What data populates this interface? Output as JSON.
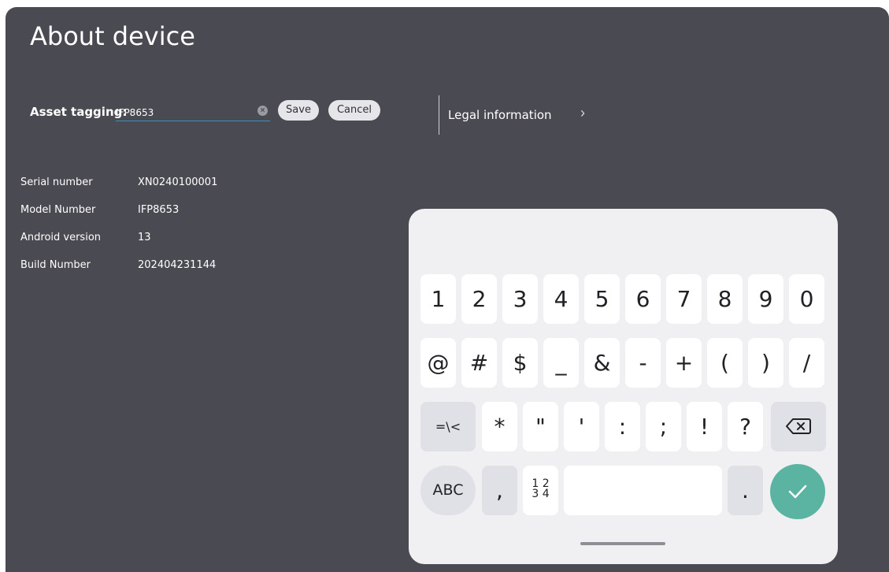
{
  "page": {
    "title": "About device"
  },
  "asset": {
    "label": "Asset tagging:",
    "value": "IFP8653",
    "clear_icon": "clear-icon",
    "save_label": "Save",
    "cancel_label": "Cancel"
  },
  "legal": {
    "label": "Legal information",
    "chevron": "›"
  },
  "info": [
    {
      "label": "Serial number",
      "value": "XN0240100001"
    },
    {
      "label": "Model Number",
      "value": "IFP8653"
    },
    {
      "label": "Android version",
      "value": "13"
    },
    {
      "label": "Build Number",
      "value": "202404231144"
    }
  ],
  "keyboard": {
    "row1": [
      "1",
      "2",
      "3",
      "4",
      "5",
      "6",
      "7",
      "8",
      "9",
      "0"
    ],
    "row2": [
      "@",
      "#",
      "$",
      "_",
      "&",
      "-",
      "+",
      "(",
      ")",
      "/"
    ],
    "row3_toggle": "=\\<",
    "row3": [
      "*",
      "\"",
      "'",
      ":",
      ";",
      "!",
      "?"
    ],
    "backspace_icon": "backspace-icon",
    "abc_label": "ABC",
    "comma": ",",
    "numtog_top": "1 2",
    "numtog_bottom": "3 4",
    "period": ".",
    "enter_icon": "checkmark-icon"
  },
  "colors": {
    "panel": "#4a4a52",
    "accent": "#5ab4a1",
    "input_underline": "#3b93b5",
    "keyboard_bg": "#f0f0f3"
  }
}
